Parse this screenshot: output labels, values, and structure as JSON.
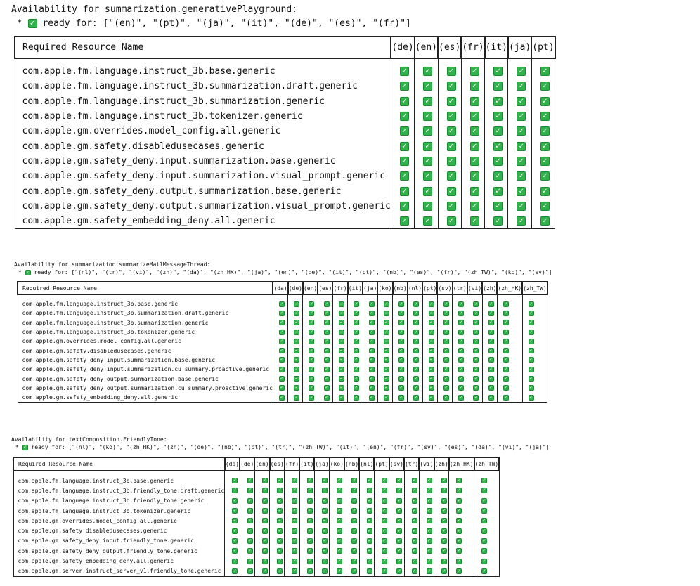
{
  "check_color": "#2fb34a",
  "check_glyph": "✓",
  "sections": [
    {
      "title": "Availability for summarization.generativePlayground:",
      "ready_prefix": "*",
      "ready_text": "ready for: [\"(en)\", \"(pt)\", \"(ja)\", \"(it)\", \"(de)\", \"(es)\", \"(fr)\"]",
      "header": "Required Resource Name",
      "languages": [
        "(de)",
        "(en)",
        "(es)",
        "(fr)",
        "(it)",
        "(ja)",
        "(pt)"
      ],
      "resources": [
        "com.apple.fm.language.instruct_3b.base.generic",
        "com.apple.fm.language.instruct_3b.summarization.draft.generic",
        "com.apple.fm.language.instruct_3b.summarization.generic",
        "com.apple.fm.language.instruct_3b.tokenizer.generic",
        "com.apple.gm.overrides.model_config.all.generic",
        "com.apple.gm.safety.disabledusecases.generic",
        "com.apple.gm.safety_deny.input.summarization.base.generic",
        "com.apple.gm.safety_deny.input.summarization.visual_prompt.generic",
        "com.apple.gm.safety_deny.output.summarization.base.generic",
        "com.apple.gm.safety_deny.output.summarization.visual_prompt.generic",
        "com.apple.gm.safety_embedding_deny.all.generic"
      ]
    },
    {
      "title": "Availability for summarization.summarizeMailMessageThread:",
      "ready_prefix": "*",
      "ready_text": "ready for: [\"(nl)\", \"(tr)\", \"(vi)\", \"(zh)\", \"(da)\", \"(zh_HK)\", \"(ja)\", \"(en)\", \"(de)\", \"(it)\", \"(pt)\", \"(nb)\", \"(es)\", \"(fr)\", \"(zh_TW)\", \"(ko)\", \"(sv)\"]",
      "header": "Required Resource Name",
      "languages": [
        "(da)",
        "(de)",
        "(en)",
        "(es)",
        "(fr)",
        "(it)",
        "(ja)",
        "(ko)",
        "(nb)",
        "(nl)",
        "(pt)",
        "(sv)",
        "(tr)",
        "(vi)",
        "(zh)",
        "(zh_HK)",
        "(zh_TW)"
      ],
      "resources": [
        "com.apple.fm.language.instruct_3b.base.generic",
        "com.apple.fm.language.instruct_3b.summarization.draft.generic",
        "com.apple.fm.language.instruct_3b.summarization.generic",
        "com.apple.fm.language.instruct_3b.tokenizer.generic",
        "com.apple.gm.overrides.model_config.all.generic",
        "com.apple.gm.safety.disabledusecases.generic",
        "com.apple.gm.safety_deny.input.summarization.base.generic",
        "com.apple.gm.safety_deny.input.summarization.cu_summary.proactive.generic",
        "com.apple.gm.safety_deny.output.summarization.base.generic",
        "com.apple.gm.safety_deny.output.summarization.cu_summary.proactive.generic",
        "com.apple.gm.safety_embedding_deny.all.generic"
      ]
    },
    {
      "title": "Availability for textComposition.FriendlyTone:",
      "ready_prefix": "*",
      "ready_text": "ready for: [\"(nl)\", \"(ko)\", \"(zh_HK)\", \"(zh)\", \"(de)\", \"(nb)\", \"(pt)\", \"(tr)\", \"(zh_TW)\", \"(it)\", \"(en)\", \"(fr)\", \"(sv)\", \"(es)\", \"(da)\", \"(vi)\", \"(ja)\"]",
      "header": "Required Resource Name",
      "languages": [
        "(da)",
        "(de)",
        "(en)",
        "(es)",
        "(fr)",
        "(it)",
        "(ja)",
        "(ko)",
        "(nb)",
        "(nl)",
        "(pt)",
        "(sv)",
        "(tr)",
        "(vi)",
        "(zh)",
        "(zh_HK)",
        "(zh_TW)"
      ],
      "resources": [
        "com.apple.fm.language.instruct_3b.base.generic",
        "com.apple.fm.language.instruct_3b.friendly_tone.draft.generic",
        "com.apple.fm.language.instruct_3b.friendly_tone.generic",
        "com.apple.fm.language.instruct_3b.tokenizer.generic",
        "com.apple.gm.overrides.model_config.all.generic",
        "com.apple.gm.safety.disabledusecases.generic",
        "com.apple.gm.safety_deny.input.friendly_tone.generic",
        "com.apple.gm.safety_deny.output.friendly_tone.generic",
        "com.apple.gm.safety_embedding_deny.all.generic",
        "com.apple.gm.server.instruct_server_v1.friendly_tone.generic"
      ]
    }
  ]
}
